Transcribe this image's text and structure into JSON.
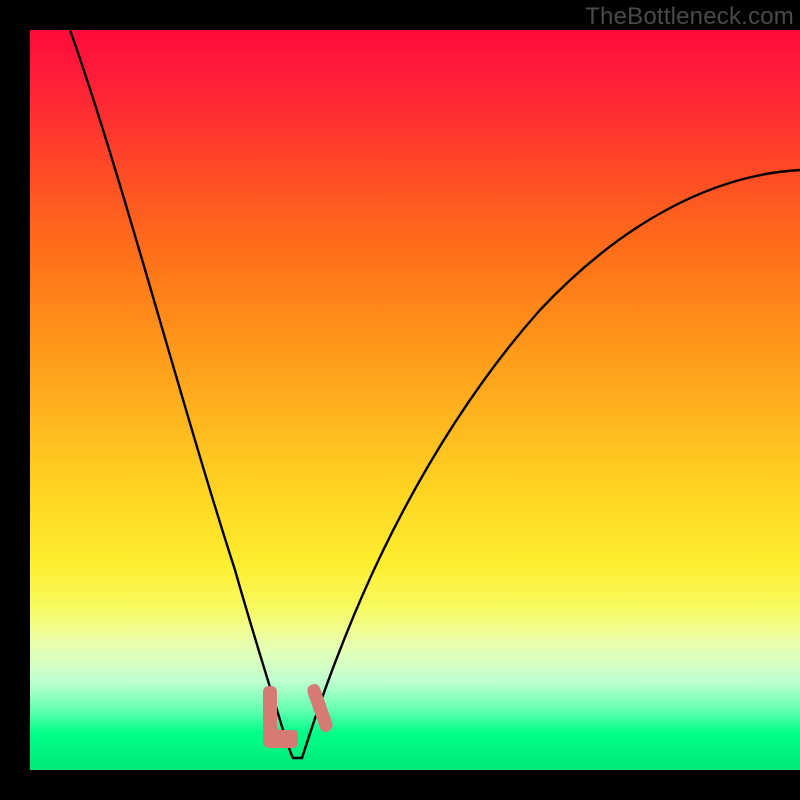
{
  "attribution": "TheBottleneck.com",
  "colors": {
    "frame": "#000000",
    "curve_stroke": "#000000",
    "marker": "#d67a74"
  },
  "chart_data": {
    "type": "line",
    "title": "",
    "xlabel": "",
    "ylabel": "",
    "xlim": [
      0,
      100
    ],
    "ylim": [
      0,
      100
    ],
    "x": [
      0,
      2,
      4,
      6,
      8,
      10,
      12,
      14,
      16,
      18,
      20,
      22,
      24,
      26,
      27.5,
      29,
      30.5,
      32,
      33,
      34,
      35,
      36,
      38,
      40,
      44,
      48,
      52,
      56,
      60,
      64,
      68,
      72,
      76,
      80,
      84,
      88,
      92,
      96,
      100
    ],
    "values": [
      100,
      97,
      94,
      90,
      86,
      82,
      77.5,
      73,
      68,
      63,
      57,
      51,
      45,
      38,
      32,
      25,
      18,
      11,
      7,
      4,
      3,
      4,
      7,
      11,
      19,
      27,
      34,
      40,
      46,
      51.5,
      56.5,
      61,
      65,
      68.5,
      72,
      75,
      77.5,
      79.5,
      81
    ],
    "markers": [
      {
        "shape": "L",
        "x_range": [
          29.5,
          33.5
        ],
        "y_range": [
          2,
          11
        ]
      },
      {
        "shape": "tick",
        "x": 35.2,
        "y_range": [
          5,
          12
        ]
      }
    ],
    "gradient_stops": [
      {
        "pos": 0.0,
        "color": "#ff0a3a"
      },
      {
        "pos": 0.25,
        "color": "#ff6a1d"
      },
      {
        "pos": 0.5,
        "color": "#ffc020"
      },
      {
        "pos": 0.75,
        "color": "#f5fa50"
      },
      {
        "pos": 0.9,
        "color": "#a0ffc0"
      },
      {
        "pos": 1.0,
        "color": "#00e878"
      }
    ]
  }
}
